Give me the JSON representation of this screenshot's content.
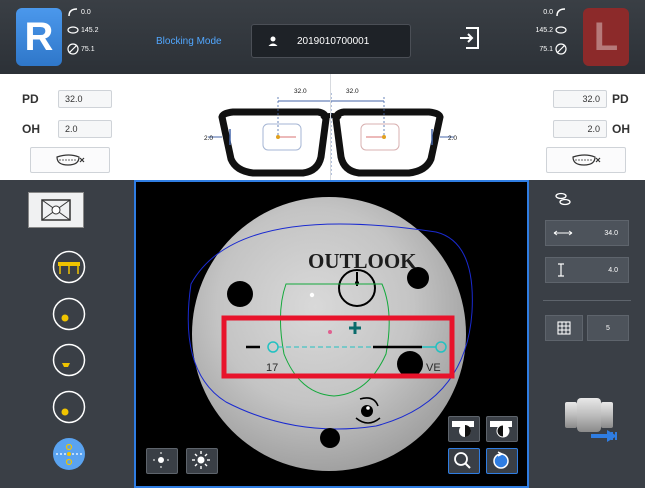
{
  "header": {
    "right_eye_label": "R",
    "left_eye_label": "L",
    "right_stats": [
      {
        "icon": "curve-icon",
        "value": "0.0"
      },
      {
        "icon": "axis-rotate-icon",
        "value": "145.2"
      },
      {
        "icon": "lens-diameter-icon",
        "value": "75.1"
      }
    ],
    "left_stats": [
      {
        "icon": "curve-icon",
        "value": "0.0"
      },
      {
        "icon": "axis-rotate-icon",
        "value": "145.2"
      },
      {
        "icon": "lens-diameter-icon",
        "value": "75.1"
      }
    ],
    "mode": "Blocking Mode",
    "job_number": "2019010700001",
    "colors": {
      "accent": "#2f7de2",
      "right_badge": "#3b88dd",
      "left_badge": "#8c2a2a"
    }
  },
  "measurement": {
    "right": {
      "pd_label": "PD",
      "pd_value": "32.0",
      "oh_label": "OH",
      "oh_value": "2.0"
    },
    "left": {
      "pd_label": "PD",
      "pd_value": "32.0",
      "oh_label": "OH",
      "oh_value": "2.0"
    },
    "diagram": {
      "pd_right": "32.0",
      "pd_left": "32.0",
      "oh_right": "2.0",
      "oh_left": "2.0"
    }
  },
  "lens_view": {
    "engraving_text": "OUTLOOK",
    "left_mark": "17",
    "right_mark": "VE"
  },
  "right_panel": {
    "width_value": "34.0",
    "height_value": "4.0",
    "grid_value": "5"
  }
}
